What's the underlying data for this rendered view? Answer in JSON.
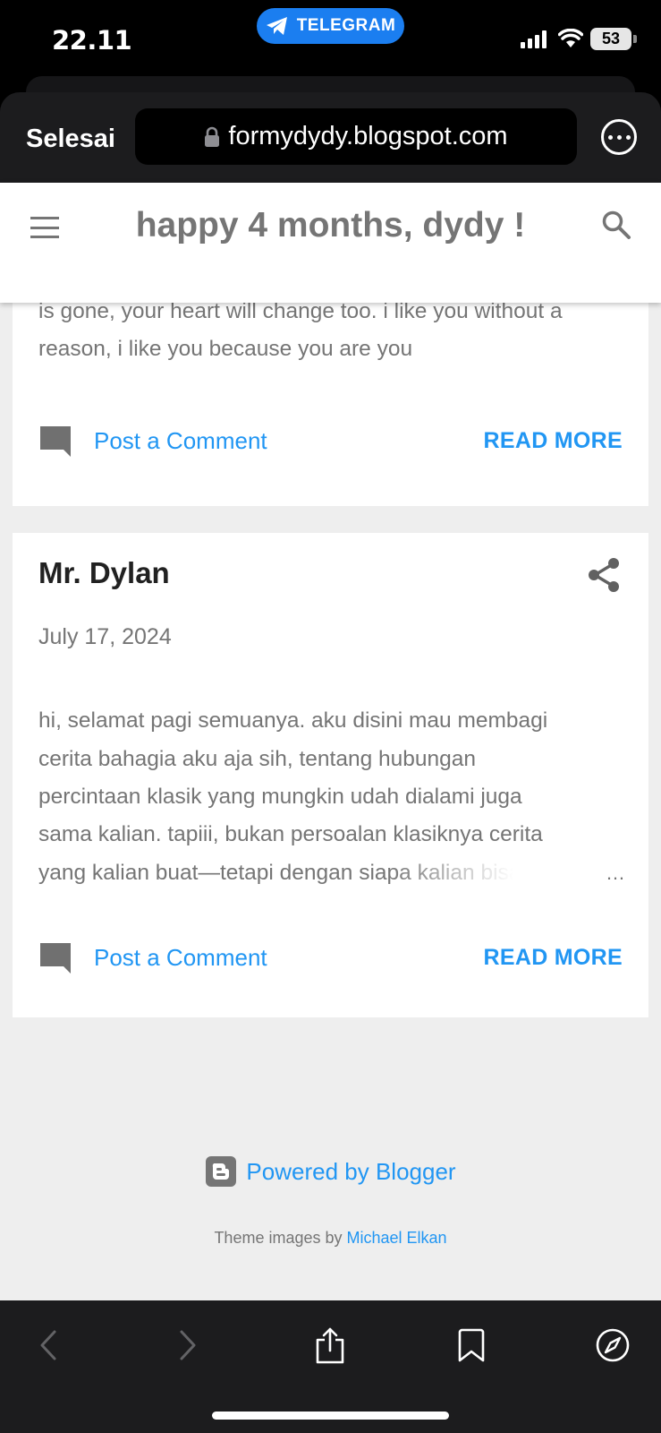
{
  "status_bar": {
    "time": "22.11",
    "telegram_label": "TELEGRAM",
    "battery_level": "53"
  },
  "browser": {
    "done_label": "Selesai",
    "url": "formydydy.blogspot.com"
  },
  "blog": {
    "title": "happy 4 months, dydy !"
  },
  "posts": [
    {
      "snippet_lines": [
        "is gone, your heart will change too. i like you without a",
        "reason, i like you because you are you"
      ],
      "comment_label": "Post a Comment",
      "read_more_label": "READ MORE"
    },
    {
      "title": "Mr. Dylan",
      "date": "July 17, 2024",
      "snippet_lines": [
        "hi, selamat pagi semuanya. aku disini mau membagi",
        "cerita bahagia aku aja sih, tentang hubungan",
        "percintaan klasik yang mungkin udah dialami juga",
        "sama kalian. tapiii, bukan persoalan klasiknya cerita",
        "yang kalian buat—tetapi dengan siapa kalian bisa"
      ],
      "ellipsis": "…",
      "comment_label": "Post a Comment",
      "read_more_label": "READ MORE"
    }
  ],
  "footer": {
    "powered_by": "Powered by Blogger",
    "theme_credit_prefix": "Theme images by ",
    "theme_credit_author": "Michael Elkan"
  },
  "colors": {
    "link_blue": "#2196f3",
    "telegram_blue": "#1b7ef0",
    "page_bg": "#eeeeee",
    "toolbar_bg": "#1c1c1e"
  },
  "icons": {
    "lock": "lock-icon",
    "more": "more-options-icon",
    "menu": "hamburger-menu-icon",
    "search": "search-icon",
    "comment": "comment-icon",
    "share": "share-icon",
    "blogger": "blogger-logo-icon",
    "back": "chevron-left-icon",
    "forward": "chevron-right-icon",
    "share_sheet": "share-sheet-icon",
    "bookmarks": "bookmark-icon",
    "compass": "compass-icon"
  }
}
